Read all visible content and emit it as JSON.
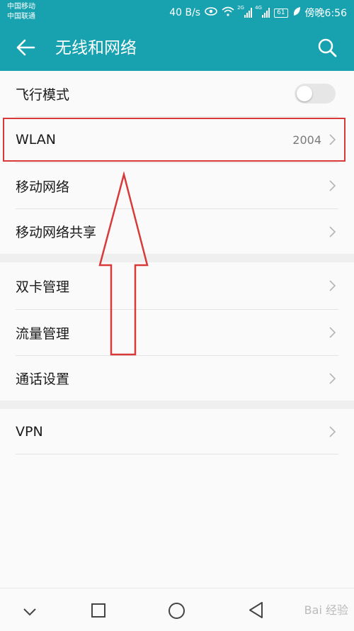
{
  "status_bar": {
    "carrier_1": "中国移动",
    "carrier_2": "中国联通",
    "network_speed": "40 B/s",
    "signal_1_type": "2G",
    "signal_2_type": "4G",
    "battery": "61",
    "time": "傍晚6:56"
  },
  "app_bar": {
    "title": "无线和网络"
  },
  "settings": {
    "airplane_mode": {
      "label": "飞行模式",
      "enabled": false
    },
    "wlan": {
      "label": "WLAN",
      "value": "2004"
    },
    "mobile_network": {
      "label": "移动网络"
    },
    "hotspot": {
      "label": "移动网络共享"
    },
    "dual_sim": {
      "label": "双卡管理"
    },
    "data_usage": {
      "label": "流量管理"
    },
    "call_settings": {
      "label": "通话设置"
    },
    "vpn": {
      "label": "VPN"
    }
  },
  "colors": {
    "accent": "#18a2b0",
    "annotation": "#d83a3a"
  },
  "watermark": "Bai 经验"
}
